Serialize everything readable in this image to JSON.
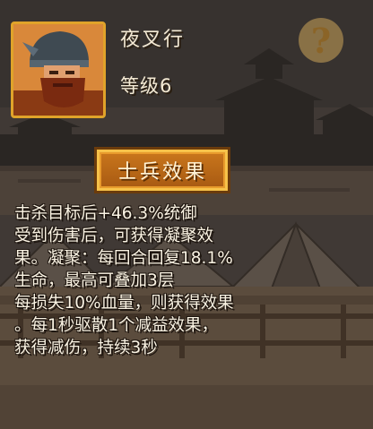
{
  "unit": {
    "name": "夜叉行",
    "level": "等级6"
  },
  "help": {
    "symbol": "?"
  },
  "section": {
    "title": "士兵效果"
  },
  "effect_lines": [
    "击杀目标后+46.3%统御",
    "受到伤害后，可获得凝聚效",
    "果。凝聚：每回合回复18.1%",
    "生命，最高可叠加3层",
    "每损失10%血量，则获得效果",
    "。每1秒驱散1个减益效果，",
    "获得减伤，持续3秒"
  ],
  "colors": {
    "text": "#fbf4e4",
    "banner_fill": "#b8651a",
    "banner_border": "#f6c24a",
    "portrait_border": "#e0a32a"
  },
  "icons": {
    "help": "question-icon",
    "portrait": "bearded-warrior-portrait"
  }
}
